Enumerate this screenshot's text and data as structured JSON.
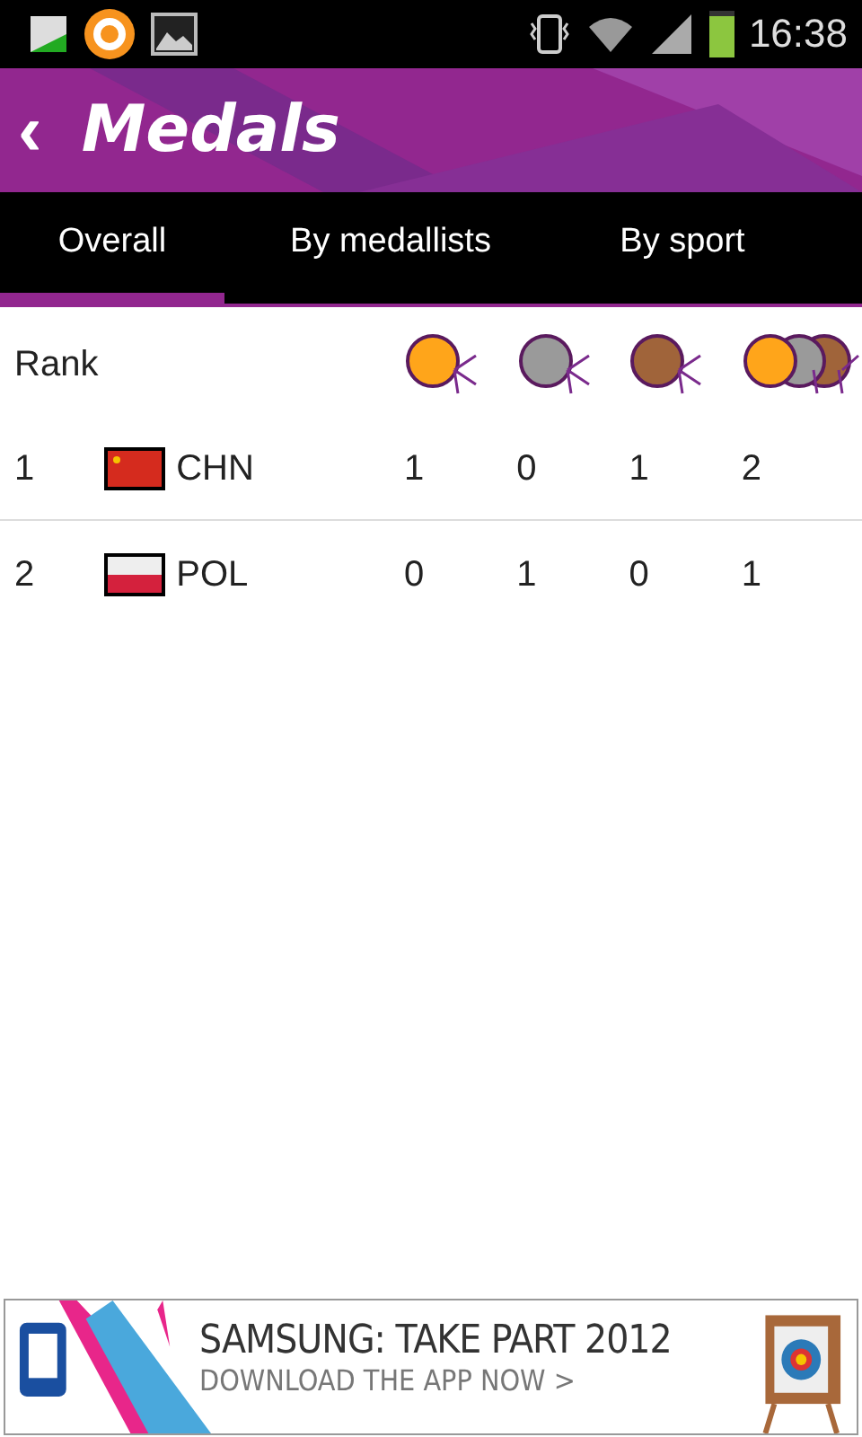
{
  "status_bar": {
    "time": "16:38"
  },
  "header": {
    "back": "‹",
    "title": "Medals"
  },
  "tabs": [
    {
      "label": "Overall",
      "selected": true
    },
    {
      "label": "By medallists",
      "selected": false
    },
    {
      "label": "By sport",
      "selected": false
    }
  ],
  "table": {
    "rank_heading": "Rank",
    "medal_columns": [
      {
        "kind": "gold"
      },
      {
        "kind": "silver"
      },
      {
        "kind": "bronze"
      },
      {
        "kind": "total"
      }
    ],
    "rows": [
      {
        "rank": "1",
        "kind": "china",
        "country": "CHN",
        "counts": [
          "1",
          "0",
          "1",
          "2"
        ]
      },
      {
        "rank": "2",
        "kind": "poland",
        "country": "POL",
        "counts": [
          "0",
          "1",
          "0",
          "1"
        ]
      }
    ]
  },
  "ad": {
    "headline": "SAMSUNG: TAKE PART 2012",
    "cta": "DOWNLOAD THE APP NOW >"
  }
}
